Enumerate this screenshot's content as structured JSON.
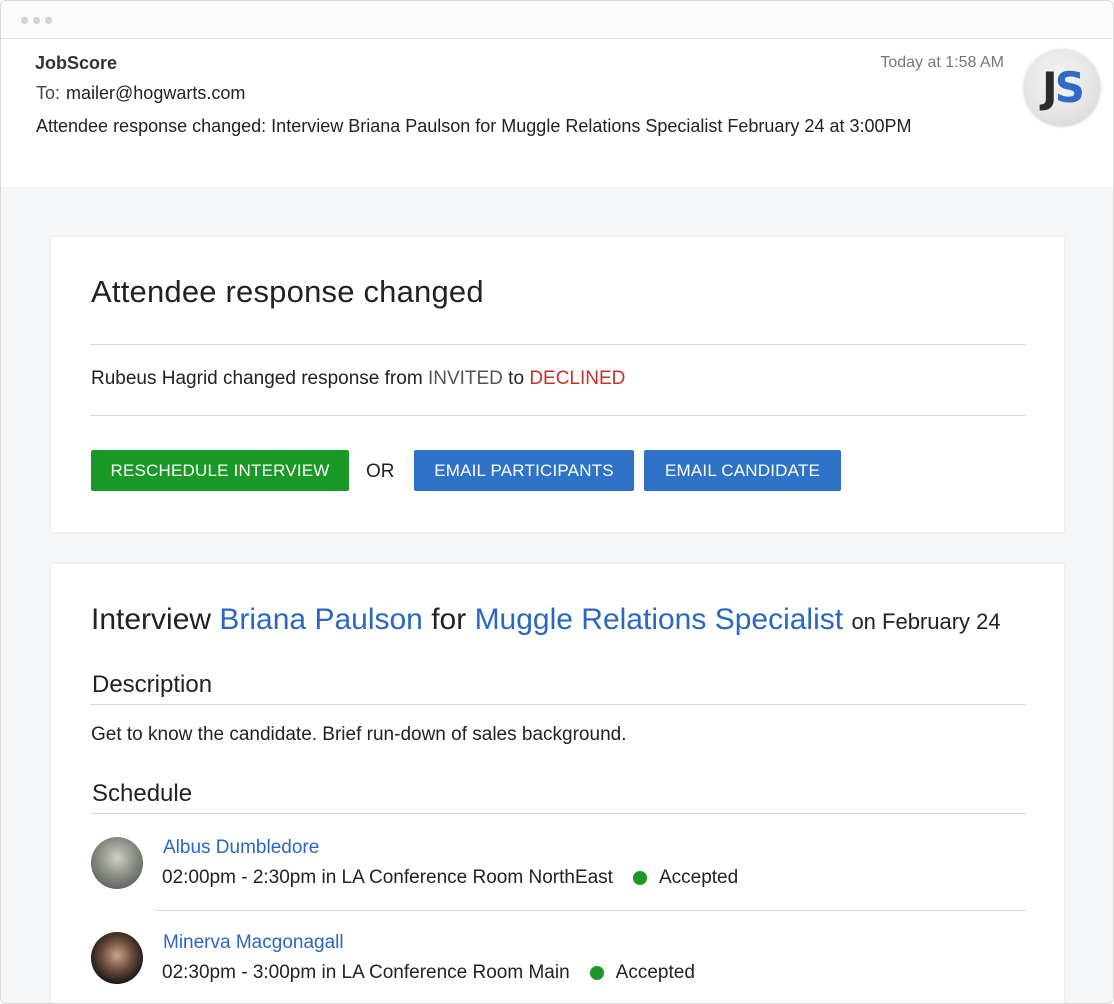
{
  "email": {
    "sender": "JobScore",
    "to_label": "To:",
    "to": "mailer@hogwarts.com",
    "subject": "Attendee response changed: Interview Briana Paulson for Muggle Relations Specialist February 24 at 3:00PM",
    "timestamp": "Today at 1:58 AM",
    "avatar_initials": "JS",
    "avatar_colors": {
      "j": "#2b2b2b",
      "s": "#2f6bc4"
    }
  },
  "response_card": {
    "title": "Attendee response changed",
    "person": "Rubeus Hagrid",
    "changed_text": "changed response from",
    "from_status": "INVITED",
    "to_word": "to",
    "to_status": "DECLINED",
    "reschedule_label": "RESCHEDULE INTERVIEW",
    "or_label": "OR",
    "email_participants_label": "EMAIL PARTICIPANTS",
    "email_candidate_label": "EMAIL CANDIDATE",
    "colors": {
      "green": "#1a9926",
      "blue": "#2f73c9",
      "declined": "#c9302c"
    }
  },
  "interview_card": {
    "prefix": "Interview",
    "candidate": "Briana Paulson",
    "for_word": "for",
    "position": "Muggle Relations Specialist",
    "date_text": "on February 24",
    "description_heading": "Description",
    "description": "Get to know the candidate. Brief run-down of sales background.",
    "schedule_heading": "Schedule",
    "attendees": [
      {
        "name": "Albus Dumbledore",
        "time": "02:00pm - 2:30pm in LA Conference Room NorthEast",
        "status": "Accepted",
        "photo_icon": "person-photo-icon"
      },
      {
        "name": "Minerva Macgonagall",
        "time": "02:30pm - 3:00pm in LA Conference Room Main",
        "status": "Accepted",
        "photo_icon": "person-photo-icon"
      }
    ]
  }
}
